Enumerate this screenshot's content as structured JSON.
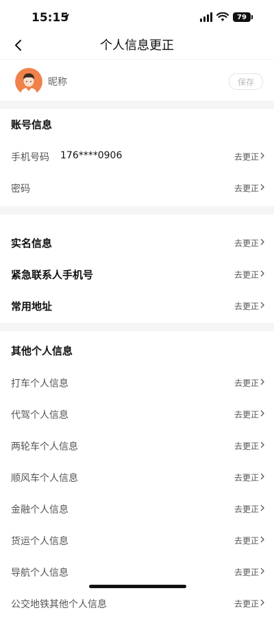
{
  "status_bar": {
    "time": "15:15",
    "battery": "79"
  },
  "nav": {
    "title": "个人信息更正"
  },
  "profile": {
    "nickname_label": "昵称",
    "save_label": "保存"
  },
  "account_section": {
    "title": "账号信息",
    "rows": [
      {
        "label": "手机号码",
        "value": "176****0906",
        "action": "去更正"
      },
      {
        "label": "密码",
        "action": "去更正"
      }
    ]
  },
  "identity_section": {
    "rows": [
      {
        "label": "实名信息",
        "action": "去更正"
      },
      {
        "label": "紧急联系人手机号",
        "action": "去更正"
      },
      {
        "label": "常用地址",
        "action": "去更正"
      }
    ]
  },
  "other_section": {
    "title": "其他个人信息",
    "rows": [
      {
        "label": "打车个人信息",
        "action": "去更正"
      },
      {
        "label": "代驾个人信息",
        "action": "去更正"
      },
      {
        "label": "两轮车个人信息",
        "action": "去更正"
      },
      {
        "label": "顺风车个人信息",
        "action": "去更正"
      },
      {
        "label": "金融个人信息",
        "action": "去更正"
      },
      {
        "label": "货运个人信息",
        "action": "去更正"
      },
      {
        "label": "导航个人信息",
        "action": "去更正"
      },
      {
        "label": "公交地铁其他个人信息",
        "action": "去更正"
      }
    ]
  }
}
